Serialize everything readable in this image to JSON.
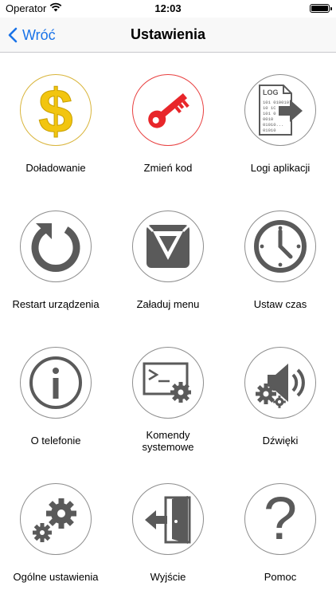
{
  "status_bar": {
    "carrier": "Operator",
    "time": "12:03",
    "battery_level": 1.0
  },
  "nav": {
    "back_label": "Wróć",
    "title": "Ustawienia"
  },
  "tiles": [
    {
      "label": "Doładowanie",
      "icon": "dollar-icon"
    },
    {
      "label": "Zmień kod",
      "icon": "key-icon"
    },
    {
      "label": "Logi aplikacji",
      "icon": "log-file-icon"
    },
    {
      "label": "Restart urządzenia",
      "icon": "restart-icon"
    },
    {
      "label": "Załaduj menu",
      "icon": "load-menu-icon"
    },
    {
      "label": "Ustaw czas",
      "icon": "clock-icon"
    },
    {
      "label": "O telefonie",
      "icon": "info-icon"
    },
    {
      "label": "Komendy systemowe",
      "icon": "terminal-gear-icon"
    },
    {
      "label": "Dźwięki",
      "icon": "speaker-gear-icon"
    },
    {
      "label": "Ogólne ustawienia",
      "icon": "gears-icon"
    },
    {
      "label": "Wyjście",
      "icon": "exit-door-icon"
    },
    {
      "label": "Pomoc",
      "icon": "question-mark-icon"
    }
  ],
  "colors": {
    "accent": "#1a73e8",
    "icon_gray": "#5a5a5a",
    "key_red": "#e8262a",
    "dollar_gold": "#f2c50f"
  }
}
